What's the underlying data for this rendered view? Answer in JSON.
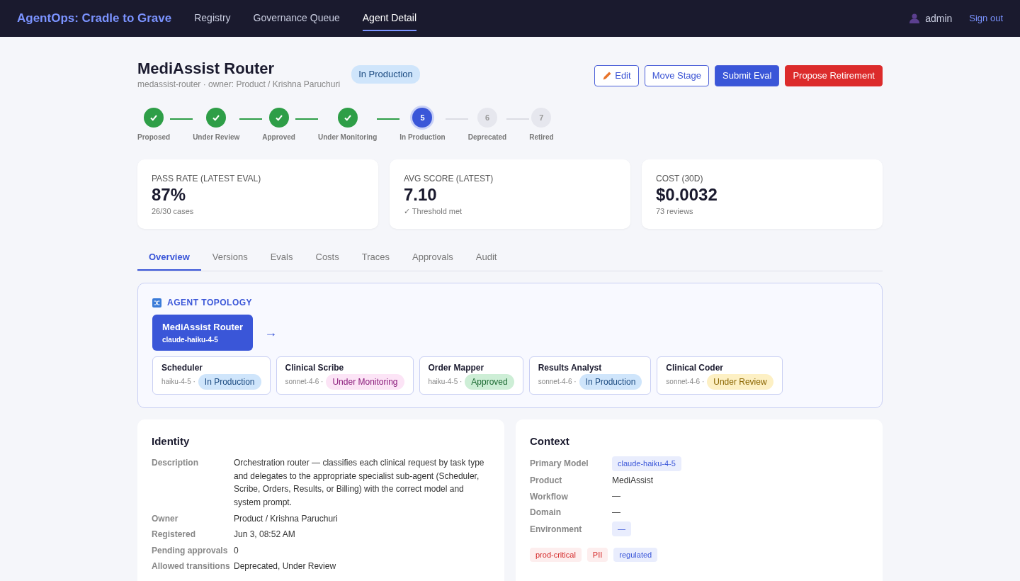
{
  "navbar": {
    "brand": "AgentOps: Cradle to Grave",
    "links": [
      {
        "label": "Registry",
        "selected": false
      },
      {
        "label": "Governance Queue",
        "selected": false
      },
      {
        "label": "Agent Detail",
        "selected": true
      }
    ],
    "user": "admin",
    "sign_out": "Sign out"
  },
  "header": {
    "title": "MediAssist Router",
    "subtitle": "medassist-router · owner: Product / Krishna Paruchuri",
    "status": {
      "label": "In Production",
      "kind": "production"
    },
    "buttons": [
      {
        "label": "Edit",
        "kind": "edit"
      },
      {
        "label": "Move Stage",
        "kind": "outline"
      },
      {
        "label": "Submit Eval",
        "kind": "primary"
      },
      {
        "label": "Propose Retirement",
        "kind": "danger"
      }
    ]
  },
  "lifecycle": [
    {
      "label": "Proposed",
      "done": true,
      "current": false
    },
    {
      "label": "Under Review",
      "done": true,
      "current": false
    },
    {
      "label": "Approved",
      "done": true,
      "current": false
    },
    {
      "label": "Under Monitoring",
      "done": true,
      "current": false
    },
    {
      "label": "In Production",
      "done": false,
      "current": true,
      "number": "5"
    },
    {
      "label": "Deprecated",
      "done": false,
      "current": false,
      "number": "6"
    },
    {
      "label": "Retired",
      "done": false,
      "current": false,
      "number": "7"
    }
  ],
  "kpis": [
    {
      "label": "PASS RATE (LATEST EVAL)",
      "value": "87%",
      "note": "26/30 cases"
    },
    {
      "label": "AVG SCORE (LATEST)",
      "value": "7.10",
      "note": "✓ Threshold met"
    },
    {
      "label": "COST (30D)",
      "value": "$0.0032",
      "note": "73 reviews"
    }
  ],
  "tabs": [
    {
      "label": "Overview",
      "selected": true
    },
    {
      "label": "Versions",
      "selected": false
    },
    {
      "label": "Evals",
      "selected": false
    },
    {
      "label": "Costs",
      "selected": false
    },
    {
      "label": "Traces",
      "selected": false
    },
    {
      "label": "Approvals",
      "selected": false
    },
    {
      "label": "Audit",
      "selected": false
    }
  ],
  "topology": {
    "title": "AGENT TOPOLOGY",
    "root": {
      "name": "MediAssist Router",
      "model": "claude-haiku-4-5"
    },
    "arrow": "→",
    "agents": [
      {
        "name": "Scheduler",
        "model": "haiku-4-5 ·",
        "status": {
          "label": "In Production",
          "kind": "production"
        }
      },
      {
        "name": "Clinical Scribe",
        "model": "sonnet-4-6 ·",
        "status": {
          "label": "Under Monitoring",
          "kind": "monitoring"
        }
      },
      {
        "name": "Order Mapper",
        "model": "haiku-4-5 ·",
        "status": {
          "label": "Approved",
          "kind": "approved"
        }
      },
      {
        "name": "Results Analyst",
        "model": "sonnet-4-6 ·",
        "status": {
          "label": "In Production",
          "kind": "production"
        }
      },
      {
        "name": "Clinical Coder",
        "model": "sonnet-4-6 ·",
        "status": {
          "label": "Under Review",
          "kind": "review"
        }
      }
    ]
  },
  "identity": {
    "title": "Identity",
    "rows": [
      {
        "label": "Description",
        "value": "Orchestration router — classifies each clinical request by task type and delegates to the appropriate specialist sub-agent (Scheduler, Scribe, Orders, Results, or Billing) with the correct model and system prompt."
      },
      {
        "label": "Owner",
        "value": "Product / Krishna Paruchuri"
      },
      {
        "label": "Registered",
        "value": "Jun 3, 08:52 AM"
      },
      {
        "label": "Pending approvals",
        "value": "0"
      },
      {
        "label": "Allowed transitions",
        "value": "Deprecated, Under Review"
      }
    ]
  },
  "context": {
    "title": "Context",
    "rows": [
      {
        "label": "Primary Model",
        "value": "claude-haiku-4-5",
        "kind": "chip"
      },
      {
        "label": "Product",
        "value": "MediAssist",
        "kind": "text"
      },
      {
        "label": "Workflow",
        "value": "—",
        "kind": "text"
      },
      {
        "label": "Domain",
        "value": "—",
        "kind": "text"
      },
      {
        "label": "Environment",
        "value": "—",
        "kind": "chip"
      }
    ],
    "tags": [
      {
        "label": "prod-critical",
        "kind": "danger"
      },
      {
        "label": "PII",
        "kind": "danger"
      },
      {
        "label": "regulated",
        "kind": "info"
      }
    ]
  }
}
